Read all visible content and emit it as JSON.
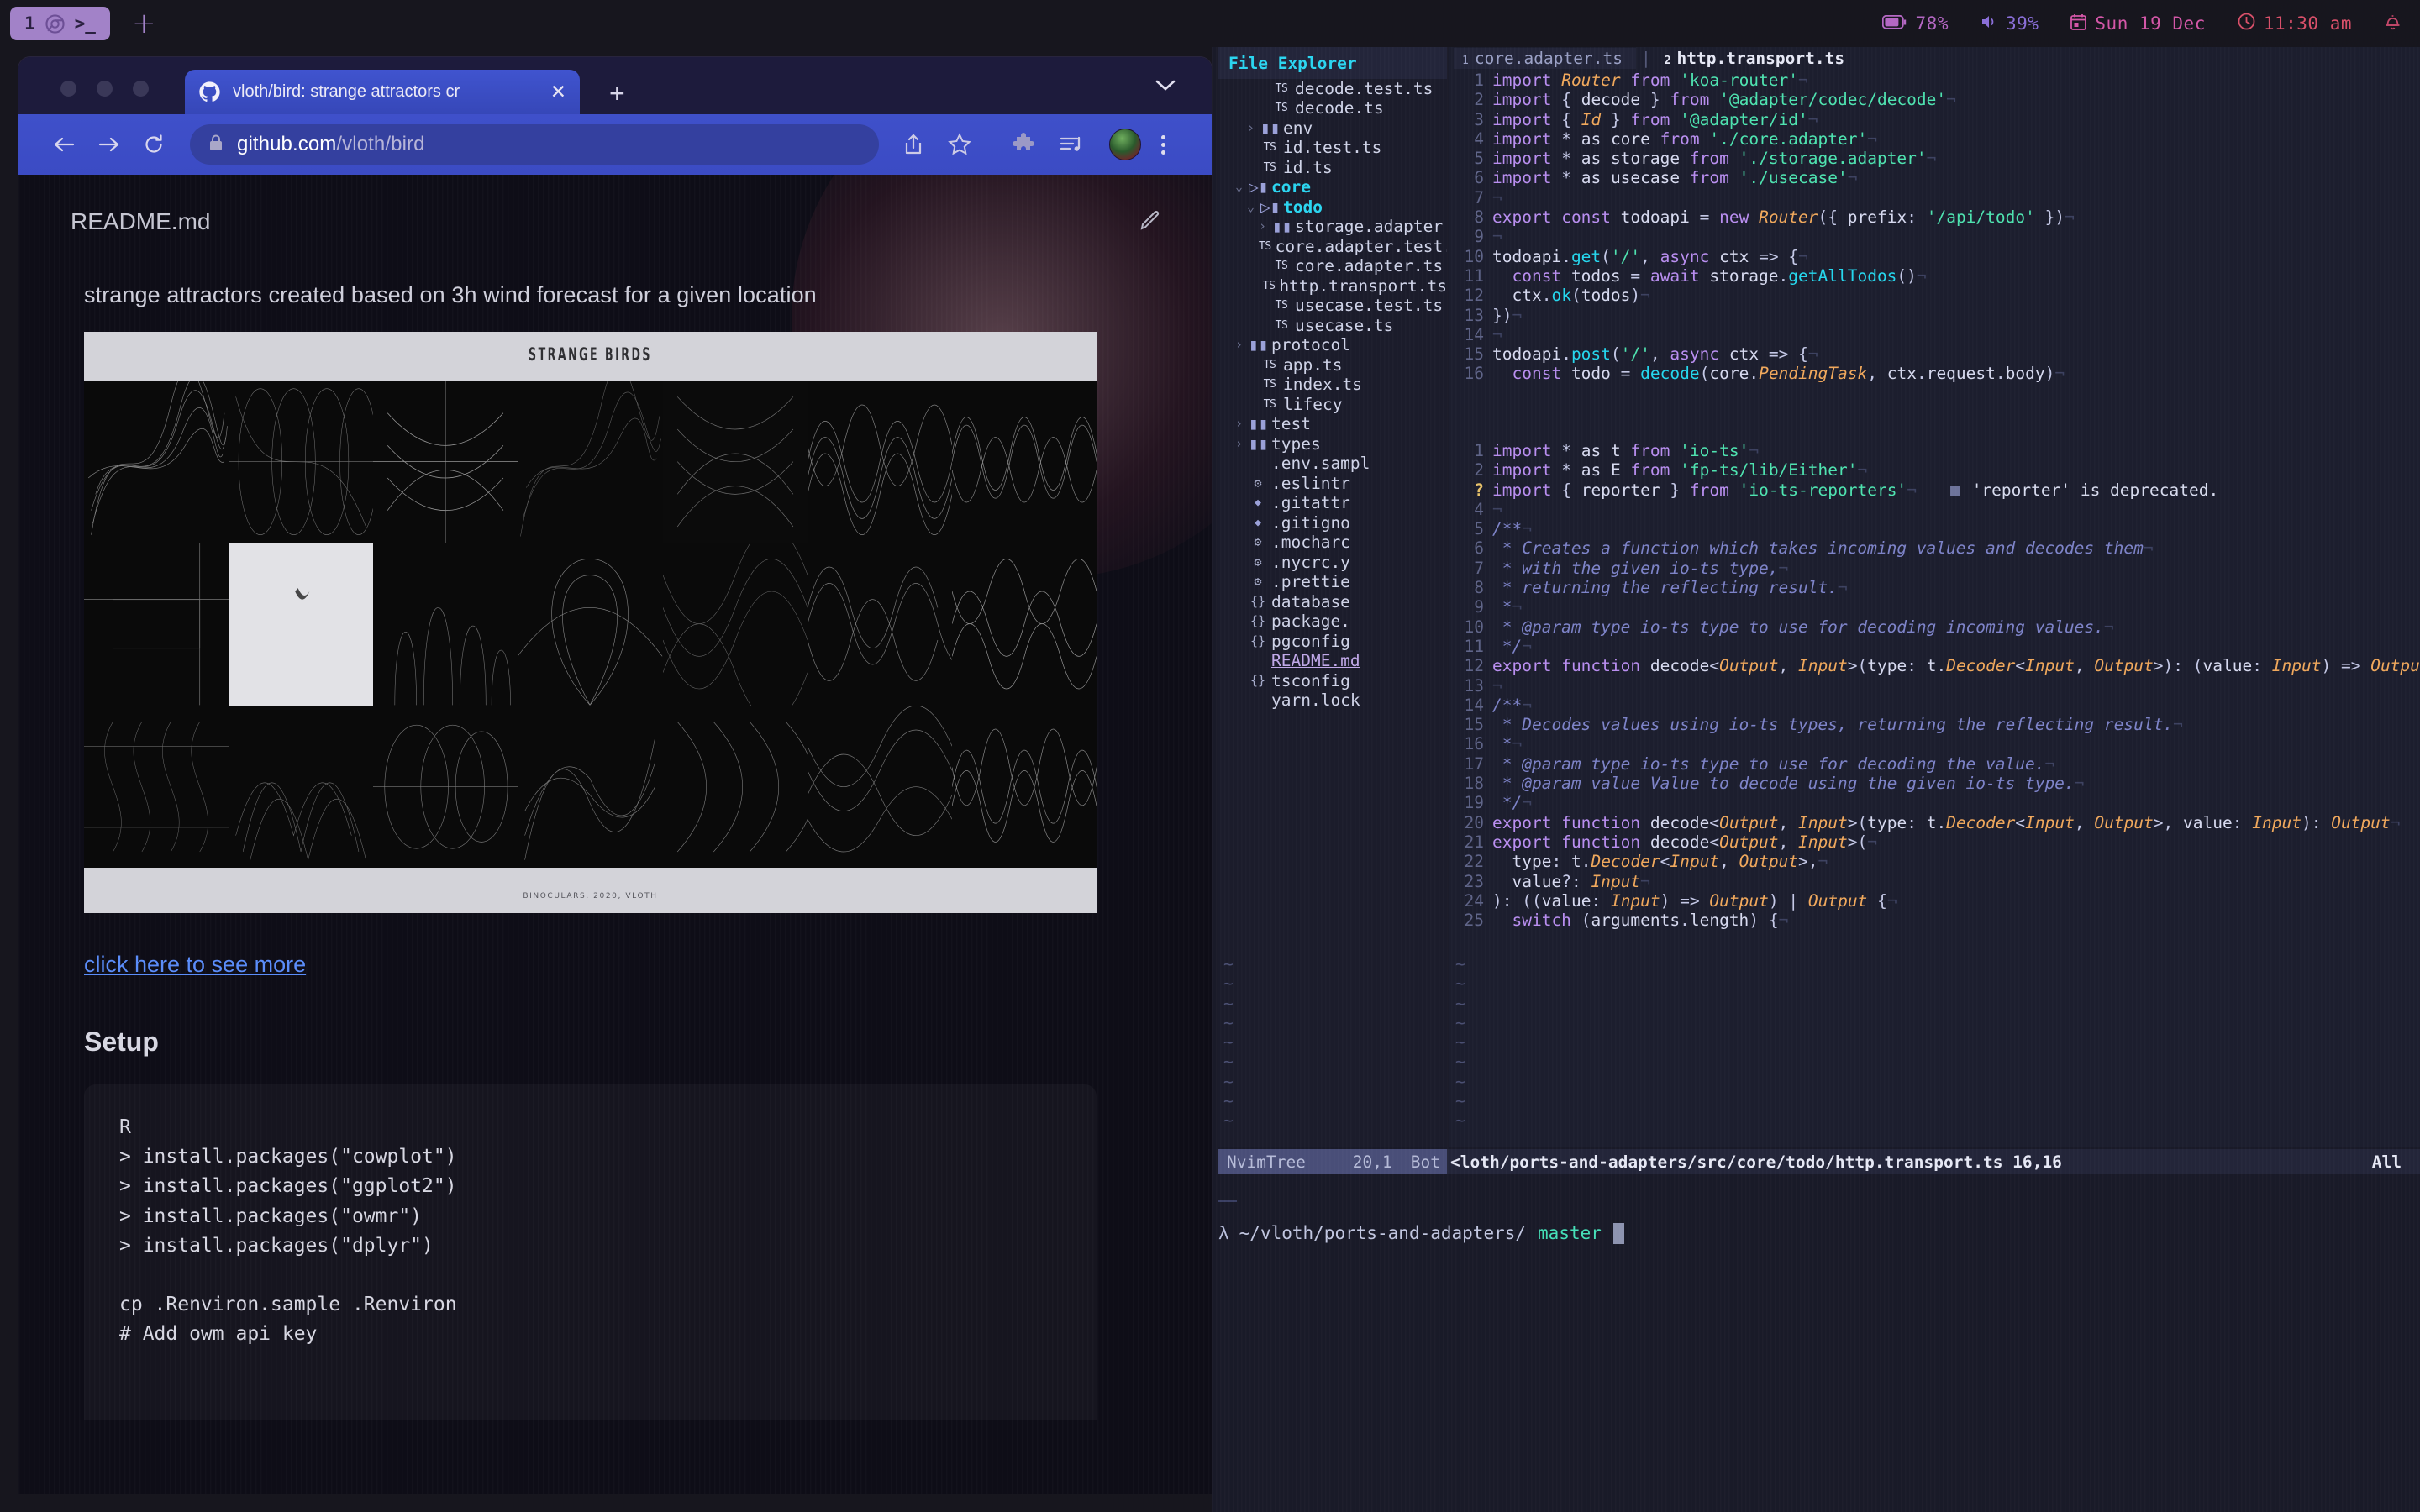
{
  "topbar": {
    "workspace_number": "1",
    "chrome_icon": "chrome-icon",
    "terminal_icon": ">_",
    "new_workspace_label": "+",
    "tray": {
      "battery": "78%",
      "volume": "39%",
      "date": "Sun 19 Dec",
      "time": "11:30 am",
      "bell_icon": "bell-icon"
    }
  },
  "browser": {
    "tab": {
      "title": "vloth/bird: strange attractors cr",
      "favicon": "github-icon",
      "close_label": "✕"
    },
    "new_tab_label": "+",
    "tab_list_chevron": "chevron-down-icon",
    "toolbar": {
      "back_icon": "back-arrow-icon",
      "forward_icon": "forward-arrow-icon",
      "reload_icon": "reload-icon",
      "lock_icon": "lock-icon",
      "url_domain": "github.com",
      "url_path": "/vloth/bird",
      "share_icon": "share-icon",
      "bookmark_icon": "star-icon",
      "extensions_icon": "puzzle-icon",
      "media_icon": "playlist-music-icon",
      "avatar": "profile-avatar",
      "menu_icon": "kebab-menu-icon"
    },
    "page": {
      "readme_filename": "README.md",
      "edit_icon": "pencil-icon",
      "description": "strange attractors created based on 3h wind forecast for a given location",
      "art": {
        "title": "STRANGE BIRDS",
        "caption": "BINOCULARS, 2020, VLOTH"
      },
      "more_link": "click here to see more",
      "setup_heading": "Setup",
      "code_block": "R\n> install.packages(\"cowplot\")\n> install.packages(\"ggplot2\")\n> install.packages(\"owmr\")\n> install.packages(\"dplyr\")\n\ncp .Renviron.sample .Renviron\n# Add owm api key"
    }
  },
  "nvim": {
    "tree": {
      "header": "File Explorer",
      "items": [
        {
          "indent": 3,
          "arrow": "",
          "icon": "ts",
          "label": "decode.test.ts",
          "kind": "file"
        },
        {
          "indent": 3,
          "arrow": "",
          "icon": "ts",
          "label": "decode.ts",
          "kind": "file"
        },
        {
          "indent": 2,
          "arrow": "›",
          "icon": "folder",
          "label": "env",
          "kind": "dir-closed"
        },
        {
          "indent": 2,
          "arrow": "",
          "icon": "ts",
          "label": "id.test.ts",
          "kind": "file"
        },
        {
          "indent": 2,
          "arrow": "",
          "icon": "ts",
          "label": "id.ts",
          "kind": "file"
        },
        {
          "indent": 1,
          "arrow": "⌄",
          "icon": "folder-open",
          "label": "core",
          "kind": "dir-open"
        },
        {
          "indent": 2,
          "arrow": "⌄",
          "icon": "folder-open",
          "label": "todo",
          "kind": "dir-open"
        },
        {
          "indent": 3,
          "arrow": "›",
          "icon": "folder",
          "label": "storage.adapter",
          "kind": "dir-closed"
        },
        {
          "indent": 3,
          "arrow": "",
          "icon": "ts",
          "label": "core.adapter.test.ts",
          "kind": "file"
        },
        {
          "indent": 3,
          "arrow": "",
          "icon": "ts",
          "label": "core.adapter.ts",
          "kind": "file"
        },
        {
          "indent": 3,
          "arrow": "",
          "icon": "ts",
          "label": "http.transport.ts",
          "kind": "file"
        },
        {
          "indent": 3,
          "arrow": "",
          "icon": "ts",
          "label": "usecase.test.ts",
          "kind": "file"
        },
        {
          "indent": 3,
          "arrow": "",
          "icon": "ts",
          "label": "usecase.ts",
          "kind": "file"
        },
        {
          "indent": 1,
          "arrow": "›",
          "icon": "folder",
          "label": "protocol",
          "kind": "dir-closed"
        },
        {
          "indent": 2,
          "arrow": "",
          "icon": "ts",
          "label": "app.ts",
          "kind": "file"
        },
        {
          "indent": 2,
          "arrow": "",
          "icon": "ts",
          "label": "index.ts",
          "kind": "file"
        },
        {
          "indent": 2,
          "arrow": "",
          "icon": "ts",
          "label": "lifecy",
          "kind": "file"
        },
        {
          "indent": 1,
          "arrow": "›",
          "icon": "folder",
          "label": "test",
          "kind": "dir-closed"
        },
        {
          "indent": 1,
          "arrow": "›",
          "icon": "folder",
          "label": "types",
          "kind": "dir-closed"
        },
        {
          "indent": 1,
          "arrow": "",
          "icon": "plain",
          "label": ".env.sampl",
          "kind": "file"
        },
        {
          "indent": 1,
          "arrow": "",
          "icon": "gear",
          "label": ".eslintr",
          "kind": "file"
        },
        {
          "indent": 1,
          "arrow": "",
          "icon": "diamond",
          "label": ".gitattr",
          "kind": "file"
        },
        {
          "indent": 1,
          "arrow": "",
          "icon": "diamond",
          "label": ".gitigno",
          "kind": "file"
        },
        {
          "indent": 1,
          "arrow": "",
          "icon": "gear",
          "label": ".mocharc",
          "kind": "file"
        },
        {
          "indent": 1,
          "arrow": "",
          "icon": "gear",
          "label": ".nycrc.y",
          "kind": "file"
        },
        {
          "indent": 1,
          "arrow": "",
          "icon": "gear",
          "label": ".prettie",
          "kind": "file"
        },
        {
          "indent": 1,
          "arrow": "",
          "icon": "brace",
          "label": "database",
          "kind": "file"
        },
        {
          "indent": 1,
          "arrow": "",
          "icon": "brace",
          "label": "package.",
          "kind": "file"
        },
        {
          "indent": 1,
          "arrow": "",
          "icon": "brace",
          "label": "pgconfig",
          "kind": "file"
        },
        {
          "indent": 1,
          "arrow": "",
          "icon": "plain",
          "label": "README.md",
          "kind": "markdown"
        },
        {
          "indent": 1,
          "arrow": "",
          "icon": "brace",
          "label": "tsconfig",
          "kind": "file"
        },
        {
          "indent": 1,
          "arrow": "",
          "icon": "plain",
          "label": "yarn.lock",
          "kind": "file"
        }
      ]
    },
    "tabline": {
      "tabs": [
        {
          "index": "1",
          "label": "core.adapter.ts",
          "active": true
        },
        {
          "index": "2",
          "label": "http.transport.ts",
          "active": false
        }
      ],
      "separator": "|"
    },
    "buffer_top": {
      "lines": [
        {
          "n": "1",
          "text": "import Router from 'koa-router'"
        },
        {
          "n": "2",
          "text": "import { decode } from '@adapter/codec/decode'"
        },
        {
          "n": "3",
          "text": "import { Id } from '@adapter/id'"
        },
        {
          "n": "4",
          "text": "import * as core from './core.adapter'"
        },
        {
          "n": "5",
          "text": "import * as storage from './storage.adapter'"
        },
        {
          "n": "6",
          "text": "import * as usecase from './usecase'"
        },
        {
          "n": "7",
          "text": ""
        },
        {
          "n": "8",
          "text": "export const todoapi = new Router({ prefix: '/api/todo' })"
        },
        {
          "n": "9",
          "text": ""
        },
        {
          "n": "10",
          "text": "todoapi.get('/', async ctx => {"
        },
        {
          "n": "11",
          "text": "  const todos = await storage.getAllTodos()"
        },
        {
          "n": "12",
          "text": "  ctx.ok(todos)"
        },
        {
          "n": "13",
          "text": "})"
        },
        {
          "n": "14",
          "text": ""
        },
        {
          "n": "15",
          "text": "todoapi.post('/', async ctx => {"
        },
        {
          "n": "16",
          "text": "  const todo = decode(core.PendingTask, ctx.request.body)"
        }
      ]
    },
    "buffer_bottom": {
      "diagnostic": "'reporter' is deprecated.",
      "diagnostic_marker": "?",
      "lines": [
        {
          "n": "1",
          "text": "import * as t from 'io-ts'"
        },
        {
          "n": "2",
          "text": "import * as E from 'fp-ts/lib/Either'"
        },
        {
          "n": "?",
          "text": "import { reporter } from 'io-ts-reporters'"
        },
        {
          "n": "4",
          "text": ""
        },
        {
          "n": "5",
          "text": "/**"
        },
        {
          "n": "6",
          "text": " * Creates a function which takes incoming values and decodes them"
        },
        {
          "n": "7",
          "text": " * with the given io-ts type,"
        },
        {
          "n": "8",
          "text": " * returning the reflecting result."
        },
        {
          "n": "9",
          "text": " *"
        },
        {
          "n": "10",
          "text": " * @param type io-ts type to use for decoding incoming values."
        },
        {
          "n": "11",
          "text": " */"
        },
        {
          "n": "12",
          "text": "export function decode<Output, Input>(type: t.Decoder<Input, Output>): (value: Input) => Output"
        },
        {
          "n": "13",
          "text": ""
        },
        {
          "n": "14",
          "text": "/**"
        },
        {
          "n": "15",
          "text": " * Decodes values using io-ts types, returning the reflecting result."
        },
        {
          "n": "16",
          "text": " *"
        },
        {
          "n": "17",
          "text": " * @param type io-ts type to use for decoding the value."
        },
        {
          "n": "18",
          "text": " * @param value Value to decode using the given io-ts type."
        },
        {
          "n": "19",
          "text": " */"
        },
        {
          "n": "20",
          "text": "export function decode<Output, Input>(type: t.Decoder<Input, Output>, value: Input): Output"
        },
        {
          "n": "21",
          "text": "export function decode<Output, Input>("
        },
        {
          "n": "22",
          "text": "  type: t.Decoder<Input, Output>,"
        },
        {
          "n": "23",
          "text": "  value?: Input"
        },
        {
          "n": "24",
          "text": "): ((value: Input) => Output) | Output {"
        },
        {
          "n": "25",
          "text": "  switch (arguments.length) {"
        }
      ]
    },
    "statusline": {
      "tree_name": "NvimTree",
      "tree_pos": "20,1",
      "tree_scroll": "Bot",
      "file_path": "<loth/ports-and-adapters/src/core/todo/http.transport.ts 16,16",
      "file_scroll": "All"
    },
    "shell": {
      "prompt_symbol": "λ",
      "cwd": "~/vloth/ports-and-adapters/",
      "branch": "master"
    }
  },
  "colors": {
    "accent_purple": "#a282c8",
    "tab_blue": "#3b4bc4",
    "link_blue": "#5b8dfa",
    "nvim_cyan": "#2bd5f0",
    "branch_green": "#45e0b8"
  }
}
